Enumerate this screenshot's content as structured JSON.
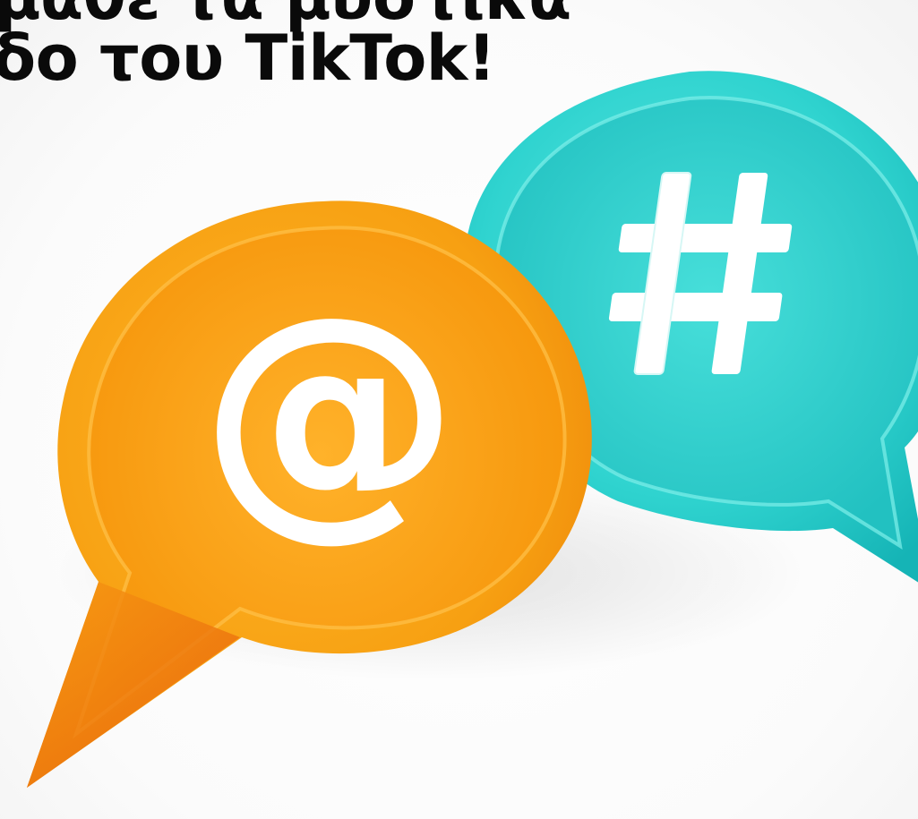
{
  "headline": {
    "line1": "μάθε τα μυστικά",
    "line2": "δο του TikTok!"
  },
  "bubbles": {
    "left": {
      "symbol": "@",
      "icon": "at-sign-icon",
      "color": "#f39a10"
    },
    "right": {
      "symbol": "#",
      "icon": "hashtag-icon",
      "color": "#2fd3cf"
    }
  }
}
